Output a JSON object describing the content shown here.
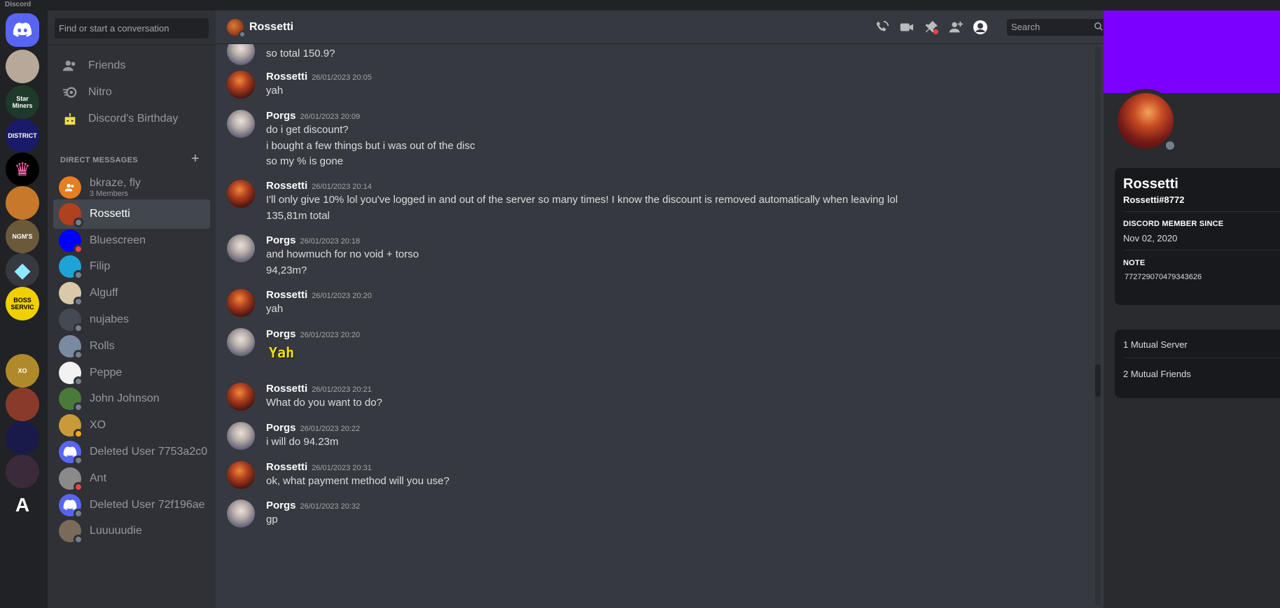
{
  "app": {
    "title": "Discord"
  },
  "sidebar": {
    "search_placeholder": "Find or start a conversation",
    "nav": [
      {
        "label": "Friends",
        "icon": "friends-icon"
      },
      {
        "label": "Nitro",
        "icon": "nitro-icon"
      },
      {
        "label": "Discord's Birthday",
        "icon": "birthday-icon"
      }
    ],
    "dm_header": "DIRECT MESSAGES",
    "dm_add": "+",
    "dms": [
      {
        "name": "bkraze, fly",
        "sub": "3 Members",
        "color": "#e67e22",
        "status": "none"
      },
      {
        "name": "Rossetti",
        "color": "#b0401f",
        "status": "offline",
        "active": true
      },
      {
        "name": "Bluescreen",
        "color": "#0000ff",
        "status": "dnd"
      },
      {
        "name": "Filip",
        "color": "#1fa2d6",
        "status": "offline"
      },
      {
        "name": "Alguff",
        "color": "#d9c9a8",
        "status": "offline"
      },
      {
        "name": "nujabes",
        "color": "#444a52",
        "status": "offline"
      },
      {
        "name": "Rolls",
        "color": "#7a8aa0",
        "status": "offline"
      },
      {
        "name": "Peppe",
        "color": "#f2f2f2",
        "status": "offline"
      },
      {
        "name": "John Johnson",
        "color": "#4a7a3a",
        "status": "offline"
      },
      {
        "name": "XO",
        "color": "#c89a3a",
        "status": "idle"
      },
      {
        "name": "Deleted User 7753a2c0",
        "color": "#5865f2",
        "status": "offline"
      },
      {
        "name": "Ant",
        "color": "#8a8a8a",
        "status": "dnd"
      },
      {
        "name": "Deleted User 72f196ae",
        "color": "#5865f2",
        "status": "offline"
      },
      {
        "name": "Luuuuudie",
        "color": "#7a6a5a",
        "status": "offline"
      }
    ]
  },
  "guilds": [
    {
      "label": "",
      "color": "#5865f2",
      "icon": "discord-home-icon"
    },
    {
      "label": "",
      "color": "#b8a89a"
    },
    {
      "label": "Star Miners",
      "color": "#1e3a2a"
    },
    {
      "label": "DISTRICT",
      "color": "#1a1a6a"
    },
    {
      "label": "♛",
      "color": "#000000"
    },
    {
      "label": "",
      "color": "#c8782a"
    },
    {
      "label": "NGM'S",
      "color": "#6a5a3a"
    },
    {
      "label": "◆",
      "color": "#36393f"
    },
    {
      "label": "BOSS SERVIC",
      "color": "#f0d000"
    },
    {
      "label": "",
      "color": "#202225"
    },
    {
      "label": "XO",
      "color": "#b08a2a"
    },
    {
      "label": "",
      "color": "#8a3a2a"
    },
    {
      "label": "",
      "color": "#1a1a4a"
    },
    {
      "label": "",
      "color": "#3a2a3a"
    },
    {
      "label": "A",
      "color": "#202225"
    }
  ],
  "chat": {
    "header_name": "Rossetti",
    "search_placeholder": "Search",
    "messages": [
      {
        "author": "",
        "time": "",
        "lines": [
          "so total 150.9?"
        ],
        "av": "porg"
      },
      {
        "author": "Rossetti",
        "time": "26/01/2023 20:05",
        "lines": [
          "yah"
        ],
        "av": "ross"
      },
      {
        "author": "Porgs",
        "time": "26/01/2023 20:09",
        "lines": [
          "do i get discount?",
          "i bought a few things but i was out of the disc",
          "so my % is gone"
        ],
        "av": "porg"
      },
      {
        "author": "Rossetti",
        "time": "26/01/2023 20:14",
        "lines": [
          "I'll only give 10% lol you've logged in and out of the server so many times! I know the discount is removed automatically when leaving lol",
          "135,81m total"
        ],
        "av": "ross"
      },
      {
        "author": "Porgs",
        "time": "26/01/2023 20:18",
        "lines": [
          "and howmuch for no void + torso",
          "94,23m?"
        ],
        "av": "porg"
      },
      {
        "author": "Rossetti",
        "time": "26/01/2023 20:20",
        "lines": [
          "yah"
        ],
        "av": "ross"
      },
      {
        "author": "Porgs",
        "time": "26/01/2023 20:20",
        "lines": [
          "Yah"
        ],
        "av": "porg",
        "emoji": true
      },
      {
        "author": "Rossetti",
        "time": "26/01/2023 20:21",
        "lines": [
          "What do you want to do?"
        ],
        "av": "ross"
      },
      {
        "author": "Porgs",
        "time": "26/01/2023 20:22",
        "lines": [
          "i will do 94.23m"
        ],
        "av": "porg"
      },
      {
        "author": "Rossetti",
        "time": "26/01/2023 20:31",
        "lines": [
          "ok, what payment method will you use?"
        ],
        "av": "ross"
      },
      {
        "author": "Porgs",
        "time": "26/01/2023 20:32",
        "lines": [
          "gp"
        ],
        "av": "porg"
      }
    ]
  },
  "profile": {
    "banner_color": "#7b00ff",
    "name": "Rossetti",
    "tag": "Rossetti#8772",
    "member_since_label": "DISCORD MEMBER SINCE",
    "member_since": "Nov 02, 2020",
    "note_label": "NOTE",
    "note": "772729070479343626",
    "mutual_servers": "1 Mutual Server",
    "mutual_friends": "2 Mutual Friends"
  }
}
